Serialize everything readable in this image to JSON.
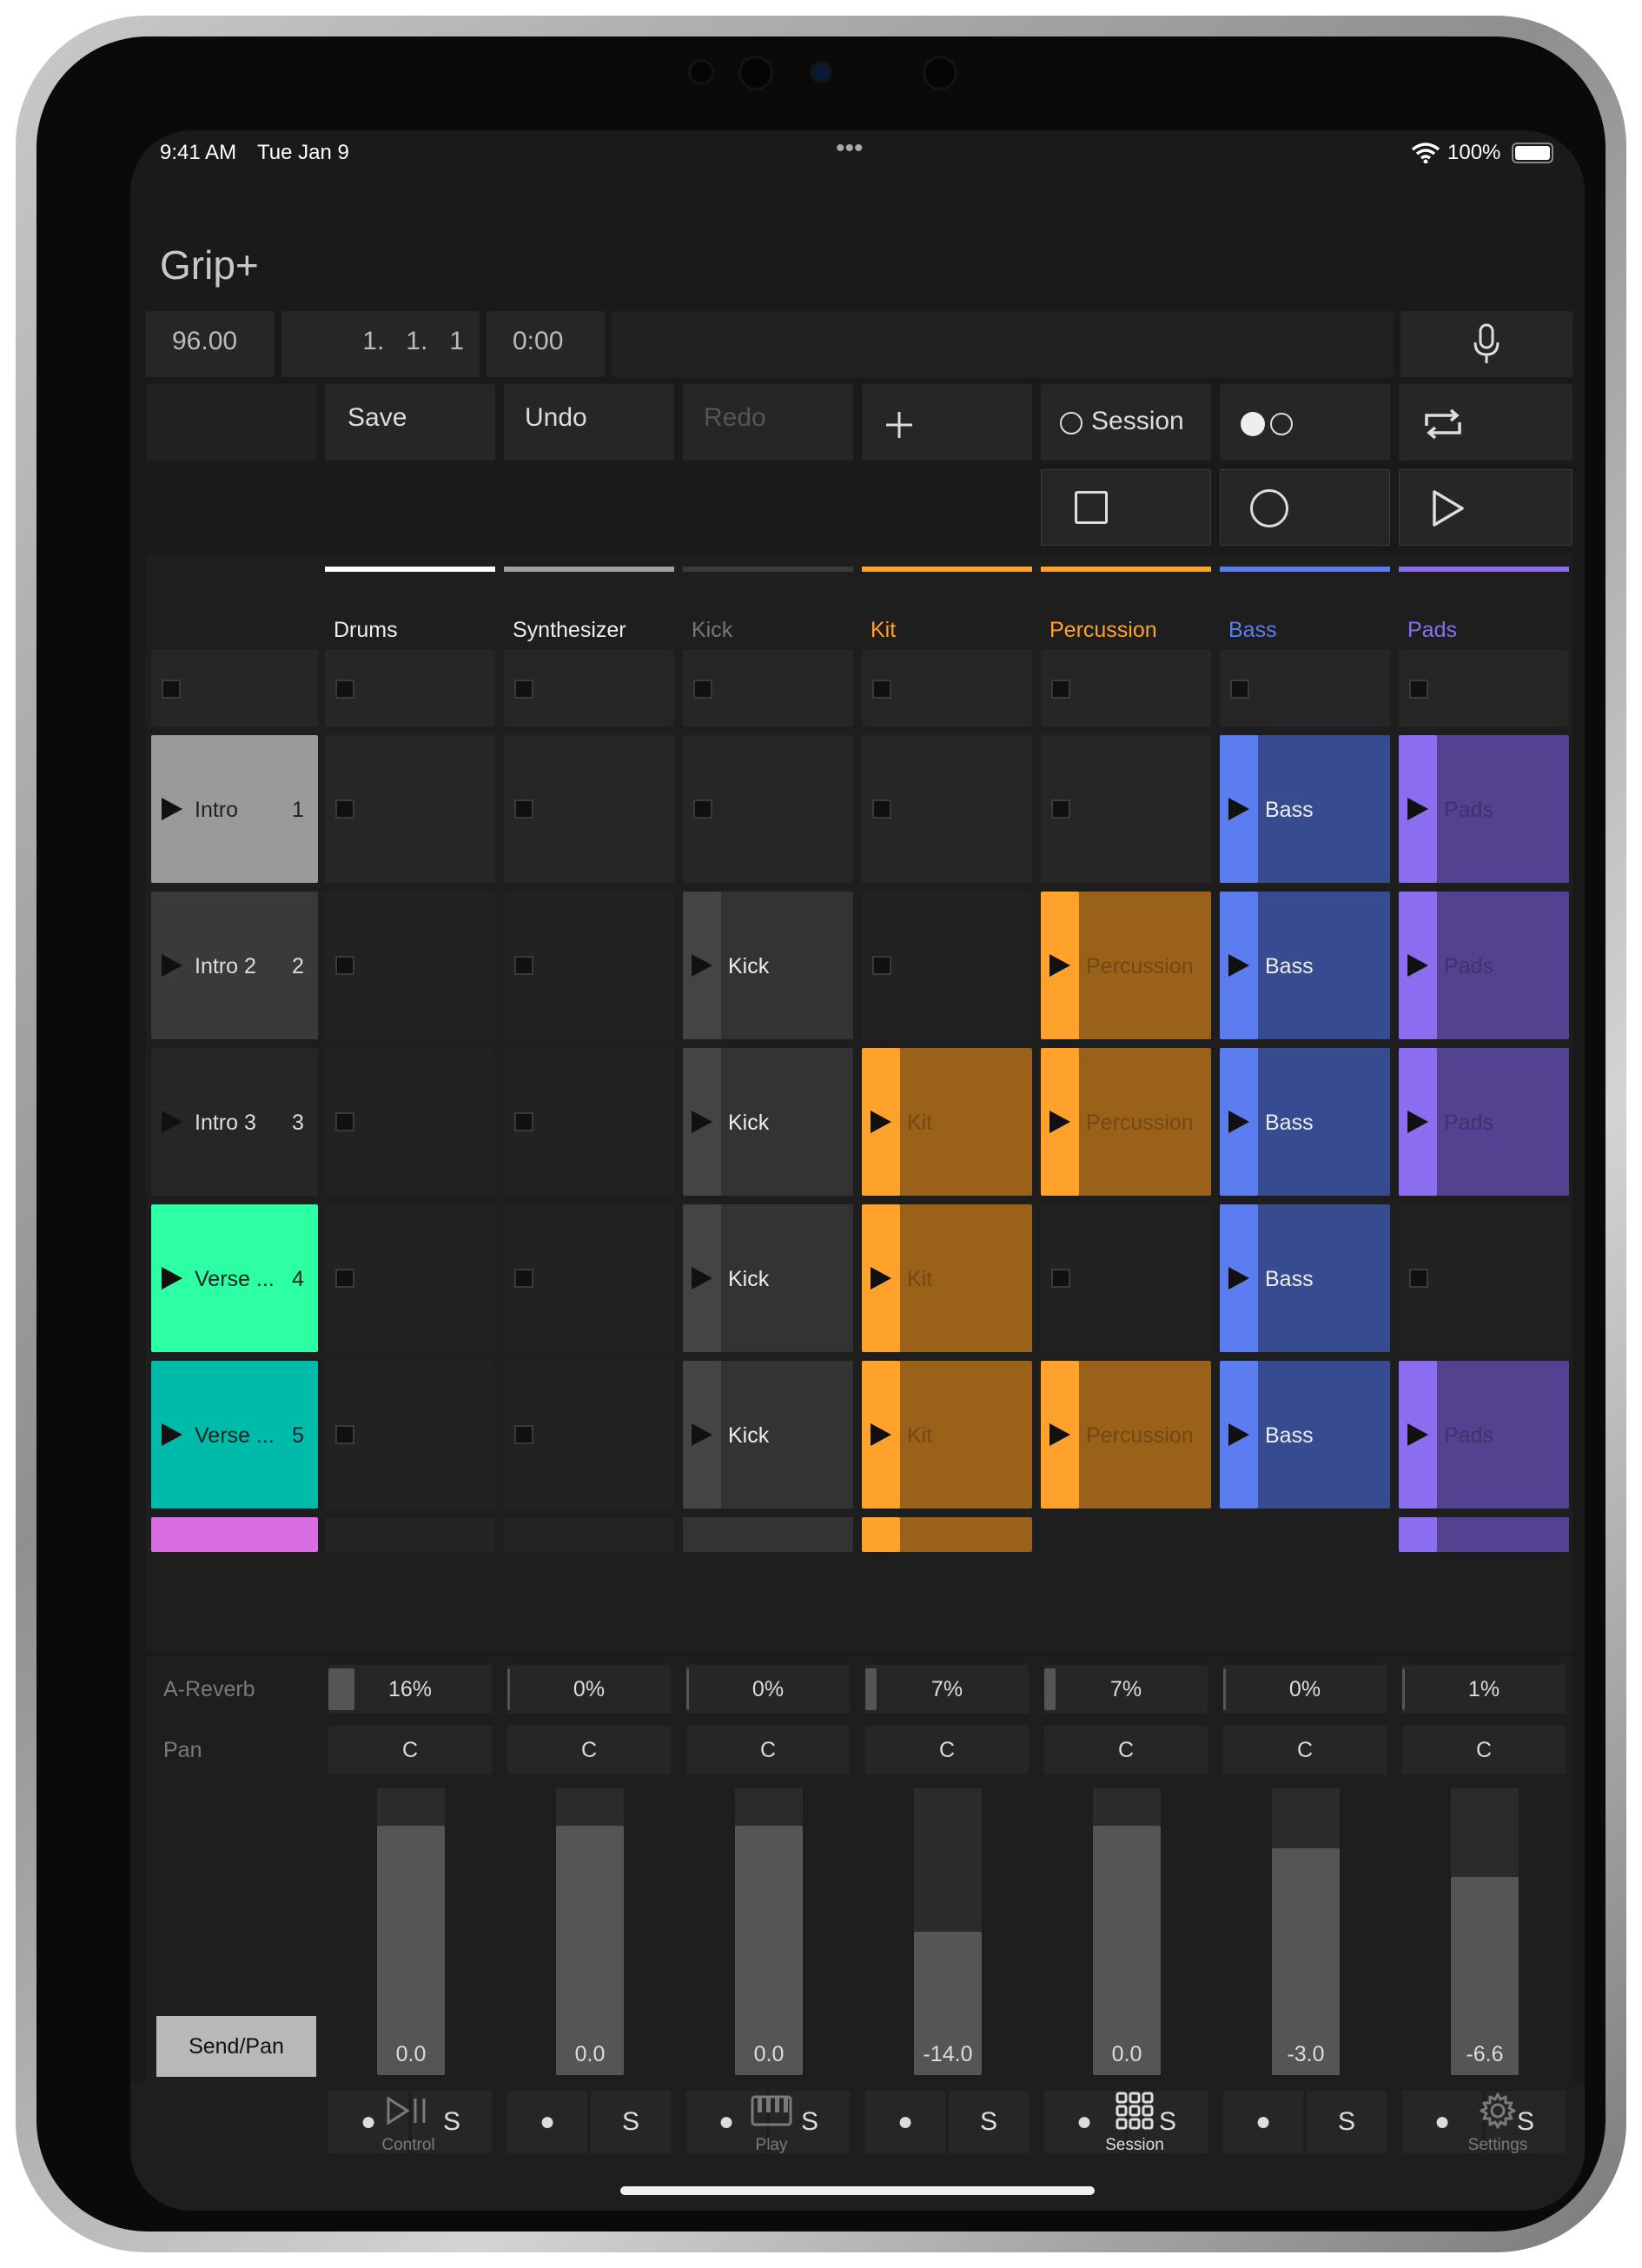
{
  "status": {
    "time": "9:41 AM",
    "date": "Tue Jan 9",
    "battery": "100%",
    "dots": "•••"
  },
  "app": {
    "title": "Grip+"
  },
  "transport": {
    "tempo": "96.00",
    "position": "1.   1.   1",
    "clock": "0:00"
  },
  "toolbar": {
    "save": "Save",
    "undo": "Undo",
    "redo": "Redo",
    "session": "Session"
  },
  "colors": {
    "white": "#ffffff",
    "gray": "#a0a0a0",
    "orange": "#ffa22b",
    "blue": "#5b7df0",
    "purple": "#8b6ef0",
    "mint": "#2cffa4",
    "teal": "#00bbaa",
    "magenta": "#d86ee2",
    "silver": "#9a9a9a"
  },
  "tracks": [
    {
      "name": "Drums",
      "color": "#ffffff",
      "send": "16%",
      "pan": "C",
      "vol": "0.0",
      "vol_level": 0.87,
      "send_level": 0.16
    },
    {
      "name": "Synthesizer",
      "color": "#a0a0a0",
      "send": "0%",
      "pan": "C",
      "vol": "0.0",
      "vol_level": 0.87,
      "send_level": 0
    },
    {
      "name": "Kick",
      "color": "#3a3a3a",
      "send": "0%",
      "pan": "C",
      "vol": "0.0",
      "vol_level": 0.87,
      "send_level": 0
    },
    {
      "name": "Kit",
      "color": "#ffa22b",
      "send": "7%",
      "pan": "C",
      "vol": "-14.0",
      "vol_level": 0.5,
      "send_level": 0.07
    },
    {
      "name": "Percussion",
      "color": "#ffa22b",
      "send": "7%",
      "pan": "C",
      "vol": "0.0",
      "vol_level": 0.87,
      "send_level": 0.07
    },
    {
      "name": "Bass",
      "color": "#5b7df0",
      "send": "0%",
      "pan": "C",
      "vol": "-3.0",
      "vol_level": 0.79,
      "send_level": 0
    },
    {
      "name": "Pads",
      "color": "#8b6ef0",
      "send": "1%",
      "pan": "C",
      "vol": "-6.6",
      "vol_level": 0.69,
      "send_level": 0.01
    }
  ],
  "scenes": [
    {
      "name": "Intro",
      "number": "1",
      "color": "#9a9a9a"
    },
    {
      "name": "Intro 2",
      "number": "2",
      "color": "#3a3a3a"
    },
    {
      "name": "Intro 3",
      "number": "3",
      "color": "#262626"
    },
    {
      "name": "Verse ...",
      "number": "4",
      "color": "#2cffa4"
    },
    {
      "name": "Verse ...",
      "number": "5",
      "color": "#00bbaa"
    }
  ],
  "clips": [
    [
      "",
      "",
      "",
      "",
      "",
      "Bass",
      "Pads"
    ],
    [
      "",
      "",
      "Kick",
      "",
      "Percussion",
      "Bass",
      "Pads"
    ],
    [
      "",
      "",
      "Kick",
      "Kit",
      "Percussion",
      "Bass",
      "Pads"
    ],
    [
      "",
      "",
      "Kick",
      "Kit",
      "",
      "Bass",
      ""
    ],
    [
      "",
      "",
      "Kick",
      "Kit",
      "Percussion",
      "Bass",
      "Pads"
    ]
  ],
  "mixer": {
    "send_label": "A-Reverb",
    "pan_label": "Pan",
    "mode_button": "Send/Pan",
    "mute_symbol": "●",
    "solo_symbol": "S"
  },
  "tabs": [
    {
      "label": "Control",
      "icon": "play-pause-icon"
    },
    {
      "label": "Play",
      "icon": "piano-icon"
    },
    {
      "label": "Session",
      "icon": "grid-icon"
    },
    {
      "label": "Settings",
      "icon": "gear-icon"
    }
  ]
}
